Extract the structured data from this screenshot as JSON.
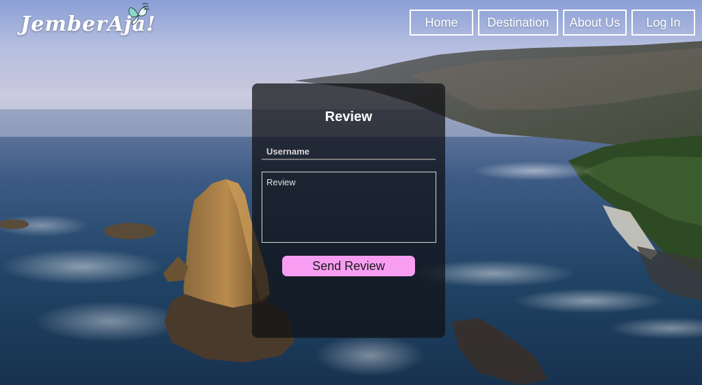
{
  "brand": {
    "logo_text": "JemberAja!",
    "logo_icon": "butterfly-icon"
  },
  "nav": {
    "items": [
      {
        "label": "Home"
      },
      {
        "label": "Destination"
      },
      {
        "label": "About Us"
      },
      {
        "label": "Log In"
      }
    ]
  },
  "form": {
    "title": "Review",
    "username_placeholder": "Username",
    "review_placeholder": "Review",
    "submit_label": "Send Review"
  },
  "colors": {
    "accent": "#f79ef2",
    "card_background": "rgba(15,15,18,0.72)",
    "nav_border": "#ffffff"
  }
}
